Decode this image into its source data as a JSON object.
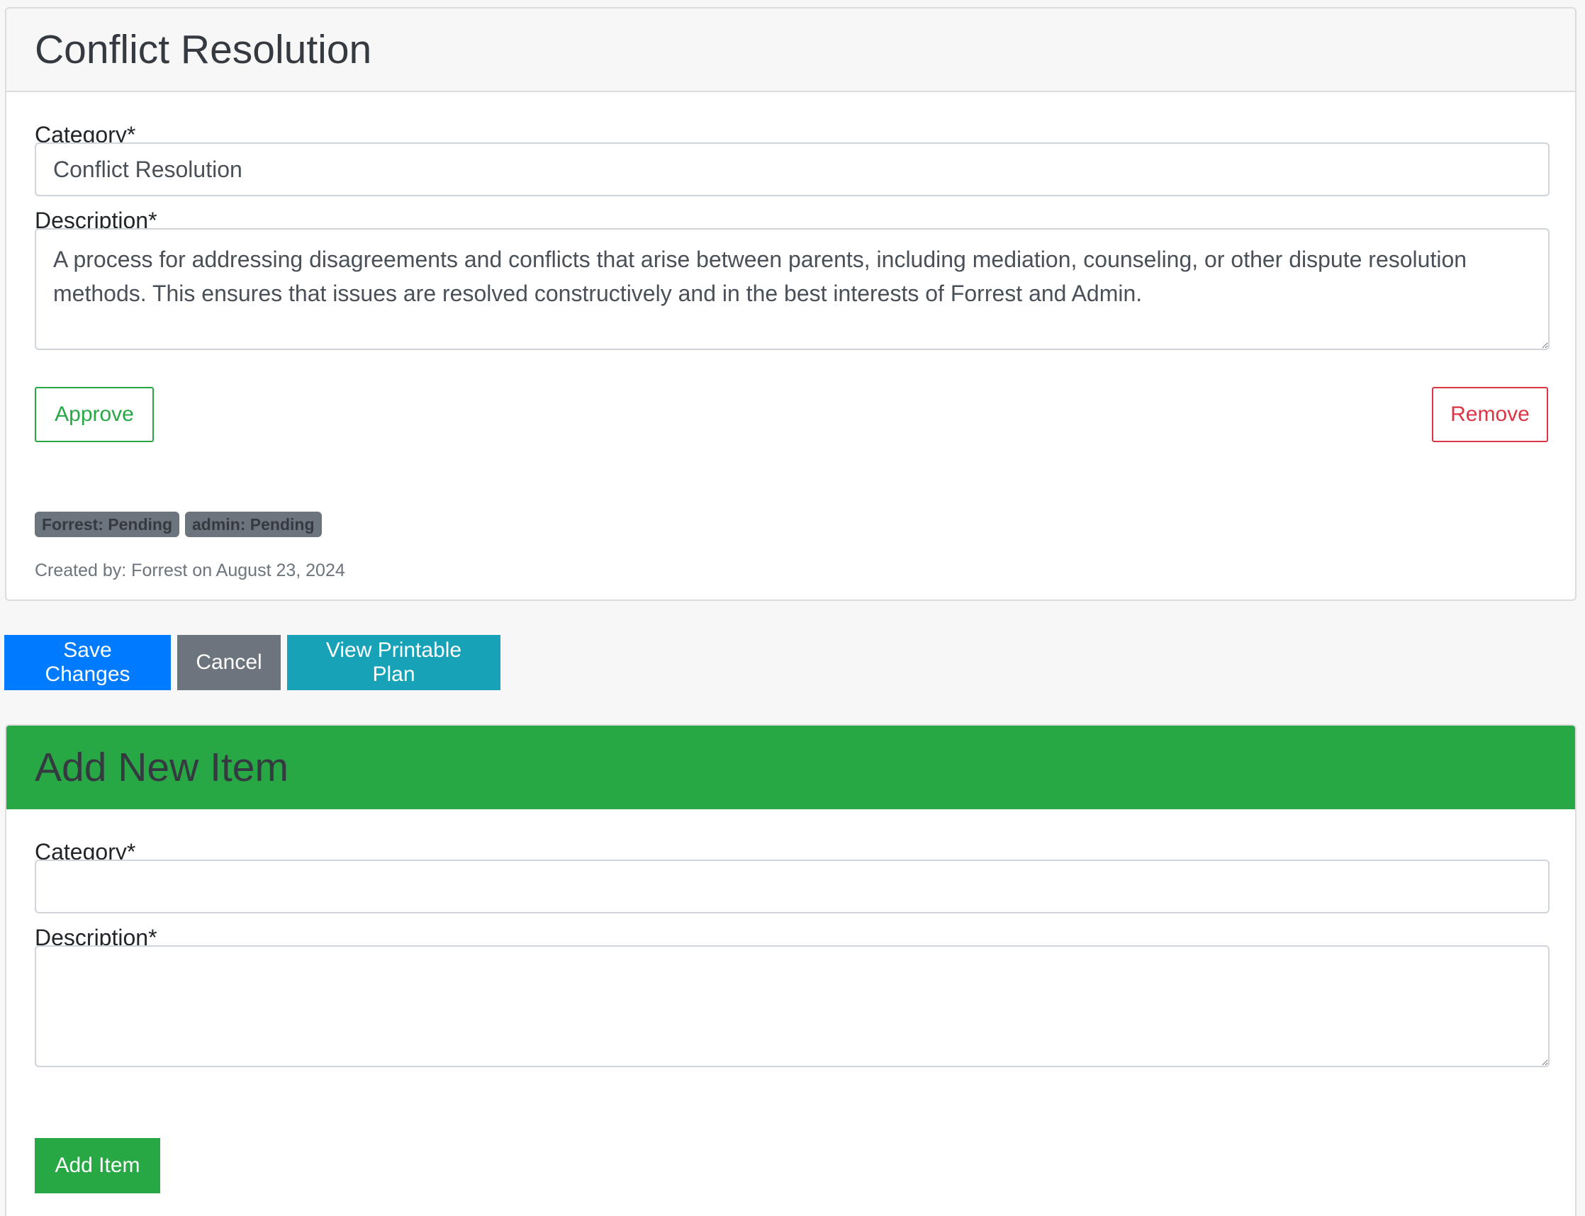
{
  "item_card": {
    "title": "Conflict Resolution",
    "category_label": "Category*",
    "category_value": "Conflict Resolution",
    "description_label": "Description*",
    "description_value": "A process for addressing disagreements and conflicts that arise between parents, including mediation, counseling, or other dispute resolution methods. This ensures that issues are resolved constructively and in the best interests of Forrest and Admin.",
    "approve_label": "Approve",
    "remove_label": "Remove",
    "badges": [
      "Forrest: Pending",
      "admin: Pending"
    ],
    "created_by": "Created by: Forrest on August 23, 2024"
  },
  "actions": {
    "save_label": "Save Changes",
    "cancel_label": "Cancel",
    "print_label": "View Printable Plan"
  },
  "new_item_card": {
    "title": "Add New Item",
    "category_label": "Category*",
    "category_value": "",
    "description_label": "Description*",
    "description_value": "",
    "add_label": "Add Item"
  },
  "colors": {
    "primary": "#007bff",
    "secondary": "#6c757d",
    "info": "#17a2b8",
    "success": "#28a745",
    "danger": "#dc3545"
  }
}
